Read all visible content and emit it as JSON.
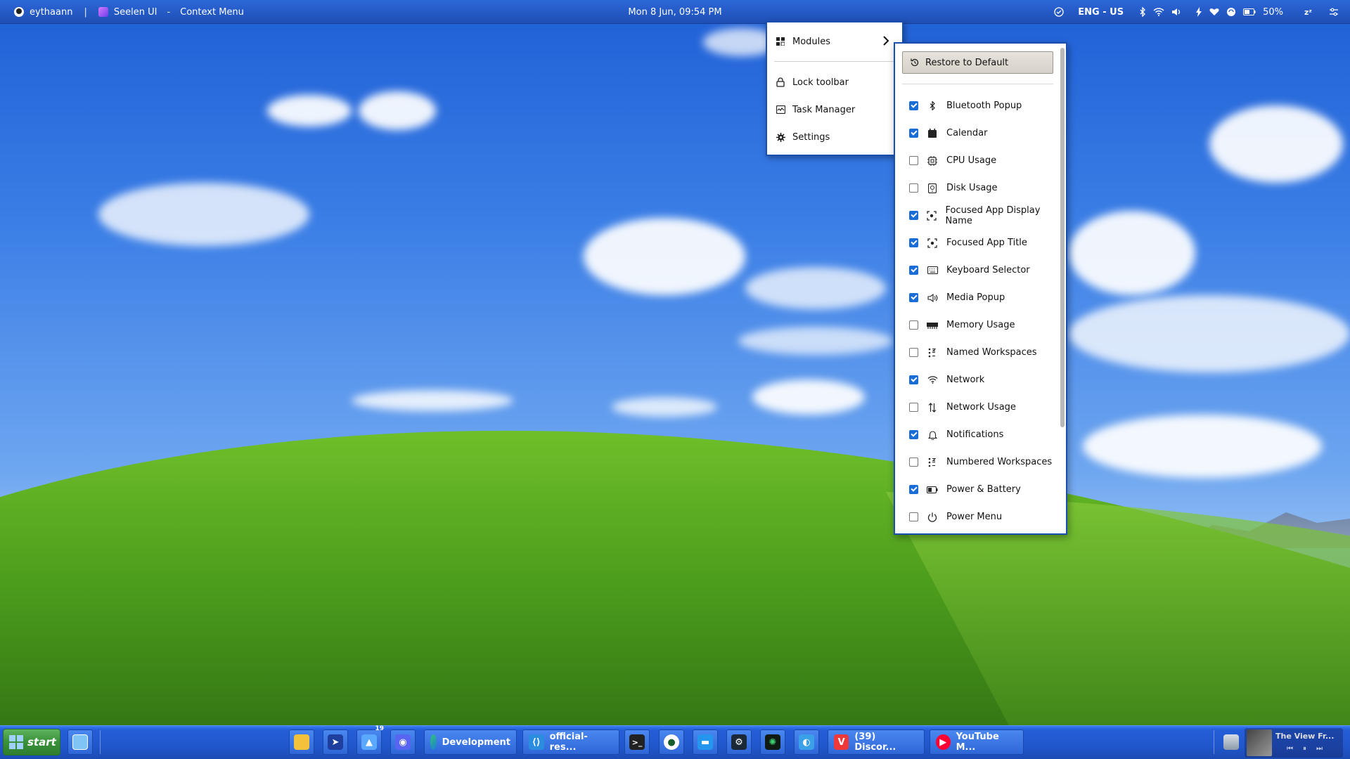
{
  "topbar": {
    "user": "eythaann",
    "separator": "|",
    "app_name": "Seelen UI",
    "dash": "-",
    "window_title": "Context Menu",
    "datetime": "Mon 8 Jun, 09:54 PM",
    "language": "ENG - US",
    "battery": "50%",
    "icons": [
      "user-avatar-icon",
      "seelen-ui-icon",
      "status-check-icon",
      "bluetooth-icon",
      "wifi-icon",
      "volume-icon",
      "charging-icon",
      "heart-icon",
      "sync-icon",
      "battery-icon",
      "sleep-icon",
      "settings-sliders-icon"
    ]
  },
  "context_menu": {
    "items": [
      {
        "label": "Modules",
        "icon": "modules-icon",
        "has_submenu": true
      },
      {
        "label": "Lock toolbar",
        "icon": "lock-icon"
      },
      {
        "label": "Task Manager",
        "icon": "task-manager-icon"
      },
      {
        "label": "Settings",
        "icon": "gear-icon"
      }
    ]
  },
  "modules_submenu": {
    "restore_label": "Restore to Default",
    "items": [
      {
        "label": "Bluetooth Popup",
        "checked": true,
        "icon": "bluetooth-icon"
      },
      {
        "label": "Calendar",
        "checked": true,
        "icon": "calendar-icon"
      },
      {
        "label": "CPU Usage",
        "checked": false,
        "icon": "cpu-icon"
      },
      {
        "label": "Disk Usage",
        "checked": false,
        "icon": "disk-icon"
      },
      {
        "label": "Focused App Display Name",
        "checked": true,
        "icon": "focus-icon"
      },
      {
        "label": "Focused App Title",
        "checked": true,
        "icon": "focus-icon"
      },
      {
        "label": "Keyboard Selector",
        "checked": true,
        "icon": "keyboard-icon"
      },
      {
        "label": "Media Popup",
        "checked": true,
        "icon": "speaker-icon"
      },
      {
        "label": "Memory Usage",
        "checked": false,
        "icon": "memory-icon"
      },
      {
        "label": "Named Workspaces",
        "checked": false,
        "icon": "workspaces-icon"
      },
      {
        "label": "Network",
        "checked": true,
        "icon": "wifi-icon"
      },
      {
        "label": "Network Usage",
        "checked": false,
        "icon": "up-down-arrows-icon"
      },
      {
        "label": "Notifications",
        "checked": true,
        "icon": "bell-icon"
      },
      {
        "label": "Numbered Workspaces",
        "checked": false,
        "icon": "workspaces-icon"
      },
      {
        "label": "Power & Battery",
        "checked": true,
        "icon": "battery-icon"
      },
      {
        "label": "Power Menu",
        "checked": false,
        "icon": "power-icon"
      }
    ]
  },
  "taskbar": {
    "start_label": "start",
    "apps": [
      {
        "label": "Development",
        "icon": "edge-icon"
      },
      {
        "label": "official-res...",
        "icon": "vscode-icon"
      },
      {
        "label": "(39) Discor...",
        "icon": "vivaldi-icon"
      },
      {
        "label": "YouTube M...",
        "icon": "youtube-music-icon"
      }
    ],
    "notification_badge": "19",
    "media_title": "The View Fr..."
  },
  "colors": {
    "accent": "#1a4fb0",
    "checkbox": "#1a6dd6",
    "taskbar": "#2157cc",
    "start_green": "#3b943b"
  }
}
